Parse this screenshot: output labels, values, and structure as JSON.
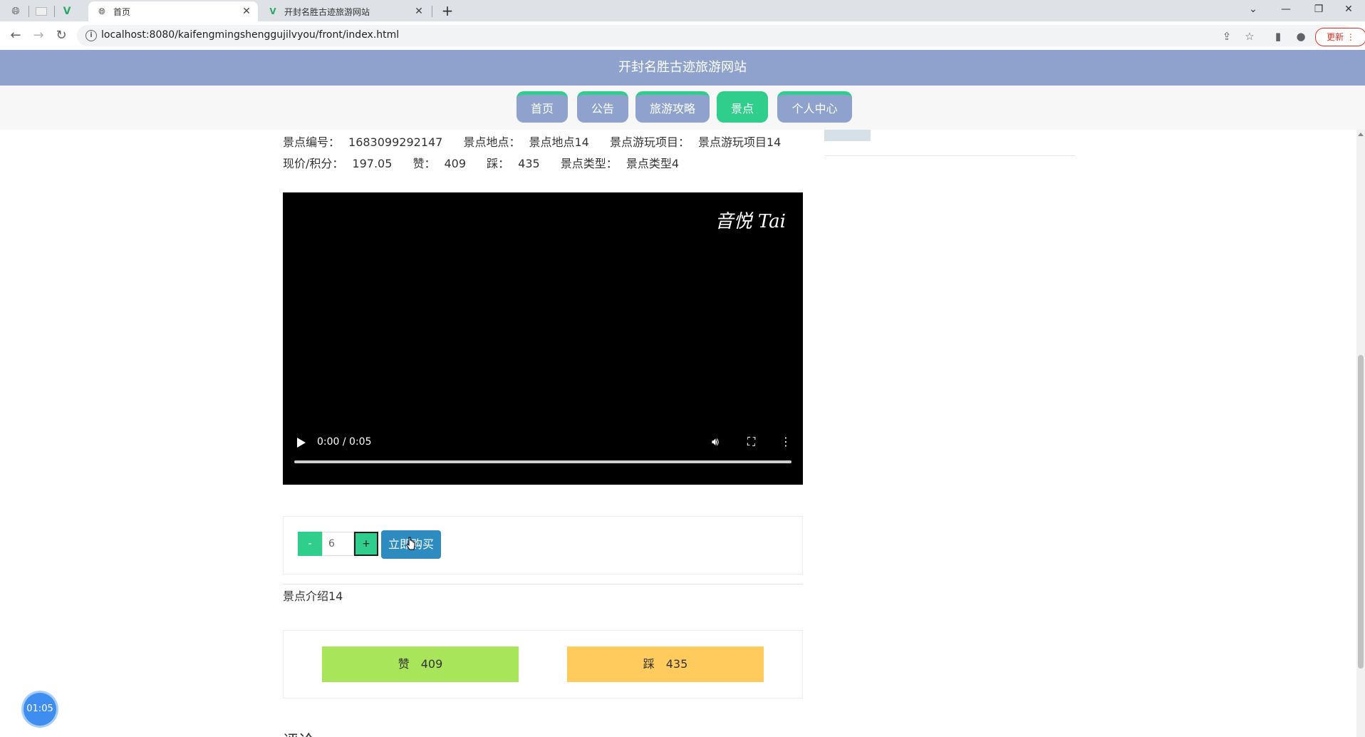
{
  "browser": {
    "tabs": [
      {
        "title": "首页",
        "active": true
      },
      {
        "title": "开封名胜古迹旅游网站",
        "active": false
      }
    ],
    "url": "localhost:8080/kaifengmingshenggujilvyou/front/index.html",
    "update_label": "更新"
  },
  "site": {
    "title": "开封名胜古迹旅游网站",
    "nav": [
      "首页",
      "公告",
      "旅游攻略",
      "景点",
      "个人中心"
    ],
    "active_nav": "景点"
  },
  "attraction": {
    "line1": [
      {
        "label": "景点编号：",
        "value": "1683099292147"
      },
      {
        "label": "景点地点：",
        "value": "景点地点14"
      },
      {
        "label": "景点游玩项目：",
        "value": "景点游玩项目14"
      }
    ],
    "line2": [
      {
        "label": "现价/积分：",
        "value": "197.05"
      },
      {
        "label": "赞：",
        "value": "409"
      },
      {
        "label": "踩：",
        "value": "435"
      },
      {
        "label": "景点类型：",
        "value": "景点类型4"
      }
    ],
    "intro": "景点介绍14"
  },
  "video": {
    "watermark": "音悦 Tai",
    "time": "0:00 / 0:05",
    "progress": 0
  },
  "purchase": {
    "minus": "-",
    "plus": "+",
    "quantity": "6",
    "buy_label": "立即购买"
  },
  "votes": {
    "like_label": "赞",
    "like_count": "409",
    "dislike_label": "踩",
    "dislike_count": "435"
  },
  "timer": "01:05",
  "next_section_heading": "评论"
}
